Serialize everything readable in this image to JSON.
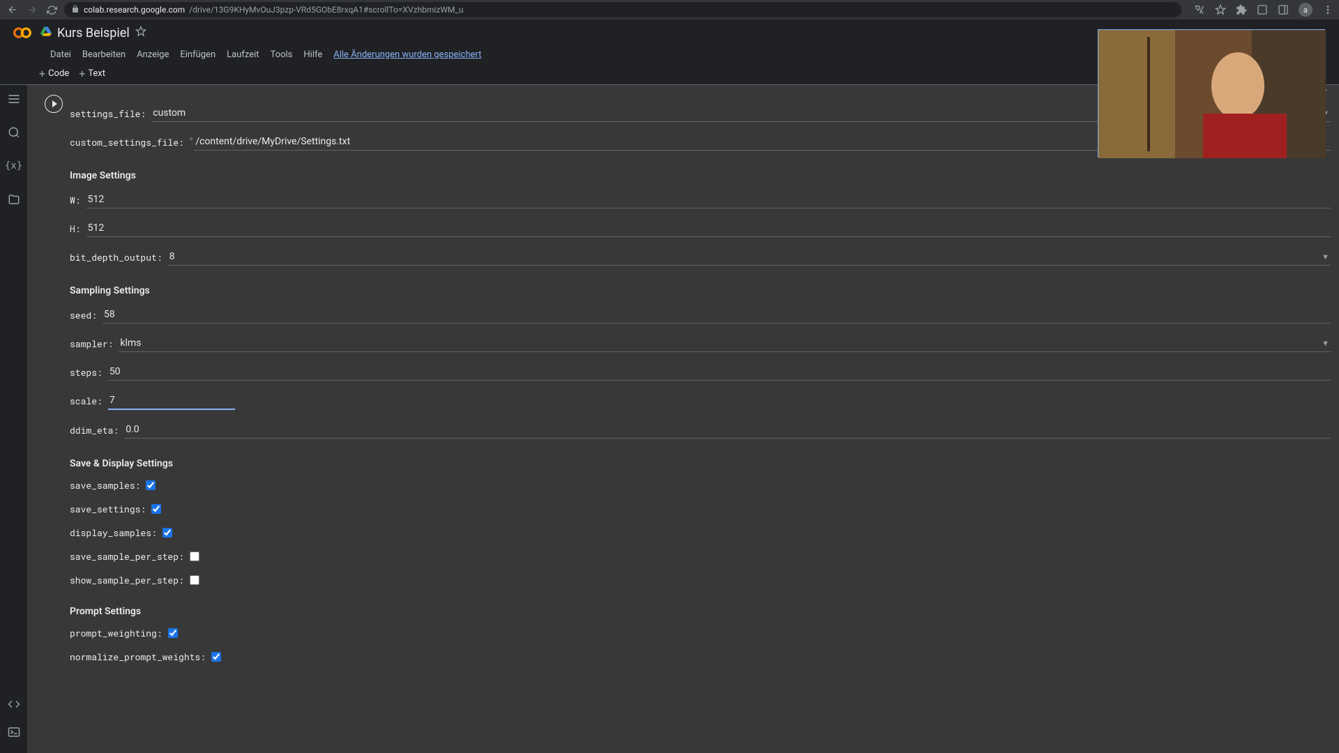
{
  "browser": {
    "url_host": "colab.research.google.com",
    "url_path": "/drive/13G9KHyMvOuJ3pzp-VRd5GObE8rxqA1#scrollTo=XVzhbmizWM_u",
    "avatar": "a"
  },
  "doc": {
    "title": "Kurs Beispiel"
  },
  "menu": {
    "datei": "Datei",
    "bearbeiten": "Bearbeiten",
    "anzeige": "Anzeige",
    "einfugen": "Einfügen",
    "laufzeit": "Laufzeit",
    "tools": "Tools",
    "hilfe": "Hilfe",
    "save_status": "Alle Änderungen wurden gespeichert"
  },
  "toolbar": {
    "code": "Code",
    "text": "Text"
  },
  "form": {
    "settings_file_label": "settings_file:",
    "settings_file_value": "custom",
    "custom_settings_file_label": "custom_settings_file:",
    "custom_settings_file_value": "/content/drive/MyDrive/Settings.txt",
    "section_image": "Image Settings",
    "w_label": "W:",
    "w_value": "512",
    "h_label": "H:",
    "h_value": "512",
    "bit_depth_label": "bit_depth_output:",
    "bit_depth_value": "8",
    "section_sampling": "Sampling Settings",
    "seed_label": "seed:",
    "seed_value": "58",
    "sampler_label": "sampler:",
    "sampler_value": "klms",
    "steps_label": "steps:",
    "steps_value": "50",
    "scale_label": "scale:",
    "scale_value": "7",
    "ddim_eta_label": "ddim_eta:",
    "ddim_eta_value": "0.0",
    "section_save": "Save & Display Settings",
    "save_samples_label": "save_samples:",
    "save_settings_label": "save_settings:",
    "display_samples_label": "display_samples:",
    "save_sample_per_step_label": "save_sample_per_step:",
    "show_sample_per_step_label": "show_sample_per_step:",
    "section_prompt": "Prompt Settings",
    "prompt_weighting_label": "prompt_weighting:",
    "normalize_prompt_weights_label": "normalize_prompt_weights:"
  }
}
